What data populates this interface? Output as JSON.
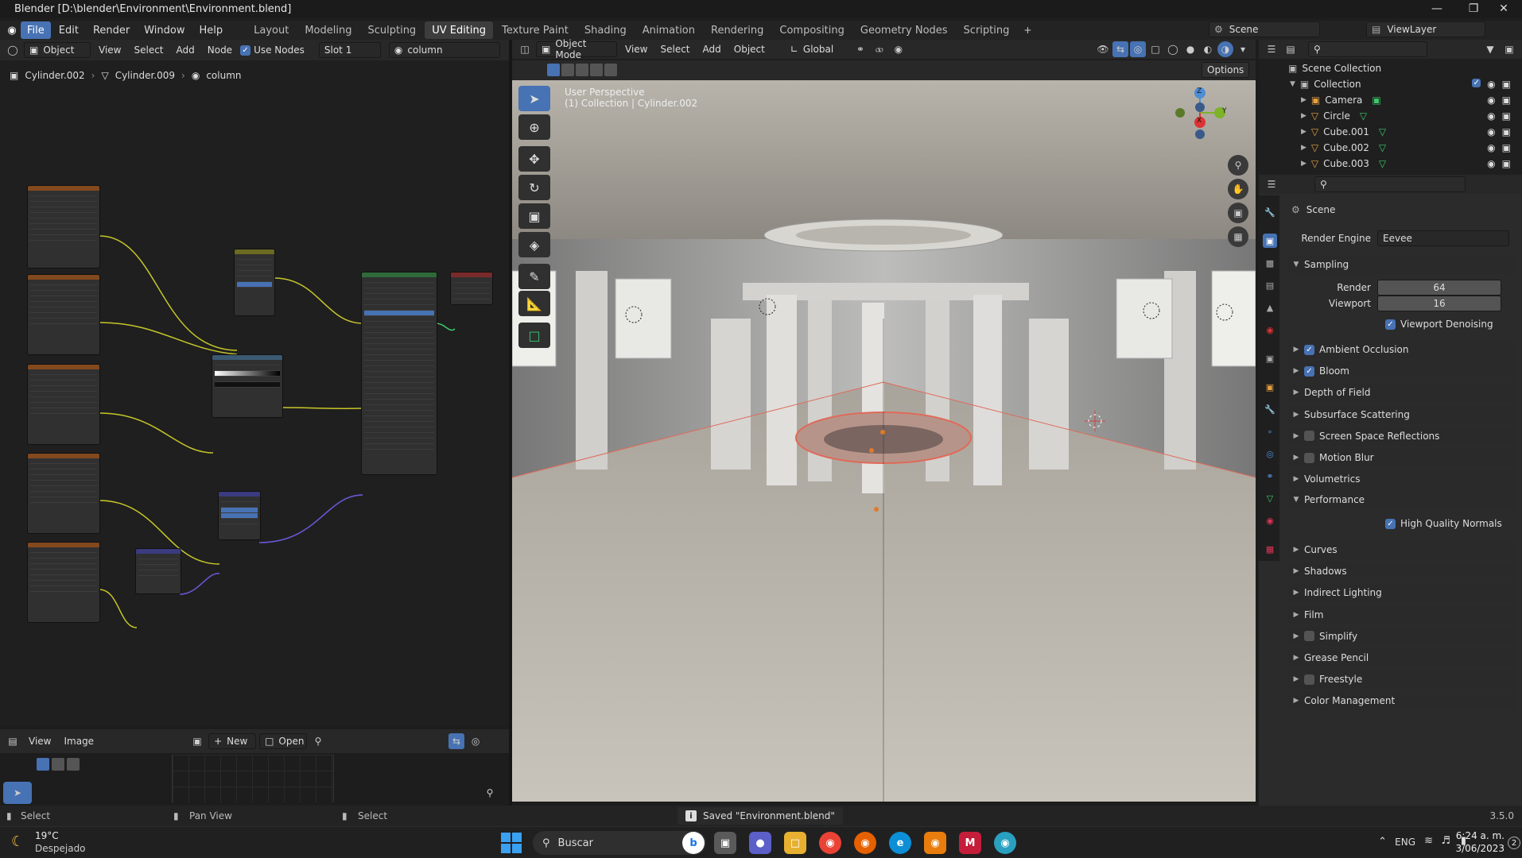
{
  "window": {
    "title": "Blender [D:\\blender\\Environment\\Environment.blend]"
  },
  "menu": [
    "File",
    "Edit",
    "Render",
    "Window",
    "Help"
  ],
  "workspaces": [
    "Layout",
    "Modeling",
    "Sculpting",
    "UV Editing",
    "Texture Paint",
    "Shading",
    "Animation",
    "Rendering",
    "Compositing",
    "Geometry Nodes",
    "Scripting"
  ],
  "active_workspace": "UV Editing",
  "scene": {
    "name": "Scene",
    "view_layer": "ViewLayer"
  },
  "node_editor": {
    "object_mode": "Object",
    "menus": [
      "View",
      "Select",
      "Add",
      "Node"
    ],
    "use_nodes_label": "Use Nodes",
    "slot": "Slot 1",
    "material": "column",
    "breadcrumb": [
      "Cylinder.002",
      "Cylinder.009",
      "column"
    ]
  },
  "image_editor": {
    "menus": [
      "View",
      "Image"
    ],
    "new_label": "New",
    "open_label": "Open"
  },
  "viewport": {
    "mode": "Object Mode",
    "menus": [
      "View",
      "Select",
      "Add",
      "Object"
    ],
    "orientation": "Global",
    "options_label": "Options",
    "overlay_line1": "User Perspective",
    "overlay_line2": "(1) Collection | Cylinder.002",
    "gizmo_axes": [
      "Z",
      "Y",
      "X"
    ]
  },
  "outliner": {
    "root": "Scene Collection",
    "collection": "Collection",
    "items": [
      "Camera",
      "Circle",
      "Cube.001",
      "Cube.002",
      "Cube.003"
    ]
  },
  "properties": {
    "scene_label": "Scene",
    "render_engine_label": "Render Engine",
    "render_engine": "Eevee",
    "sampling_label": "Sampling",
    "render_label": "Render",
    "render_samples": "64",
    "viewport_label": "Viewport",
    "viewport_samples": "16",
    "viewport_denoising": "Viewport Denoising",
    "performance_label": "Performance",
    "high_quality_normals": "High Quality Normals",
    "sections_a": [
      {
        "label": "Ambient Occlusion",
        "checkbox": true
      },
      {
        "label": "Bloom",
        "checkbox": true
      },
      {
        "label": "Depth of Field",
        "checkbox": null
      },
      {
        "label": "Subsurface Scattering",
        "checkbox": null
      },
      {
        "label": "Screen Space Reflections",
        "checkbox": false
      },
      {
        "label": "Motion Blur",
        "checkbox": false
      },
      {
        "label": "Volumetrics",
        "checkbox": null
      }
    ],
    "sections_b": [
      {
        "label": "Curves",
        "checkbox": null
      },
      {
        "label": "Shadows",
        "checkbox": null
      },
      {
        "label": "Indirect Lighting",
        "checkbox": null
      },
      {
        "label": "Film",
        "checkbox": null
      },
      {
        "label": "Simplify",
        "checkbox": false
      },
      {
        "label": "Grease Pencil",
        "checkbox": null
      },
      {
        "label": "Freestyle",
        "checkbox": false
      },
      {
        "label": "Color Management",
        "checkbox": null
      }
    ]
  },
  "statusbar": {
    "left": [
      "Select",
      "Pan View",
      "Select"
    ],
    "message": "Saved \"Environment.blend\"",
    "version": "3.5.0"
  },
  "taskbar": {
    "weather_temp": "19°C",
    "weather_desc": "Despejado",
    "search": "Buscar",
    "lang": "ENG",
    "time": "6:24 a. m.",
    "date": "3/06/2023",
    "notifications": "2"
  },
  "colors": {
    "accent": "#4772b3",
    "header": "#303030",
    "bg": "#1d1d1d"
  }
}
